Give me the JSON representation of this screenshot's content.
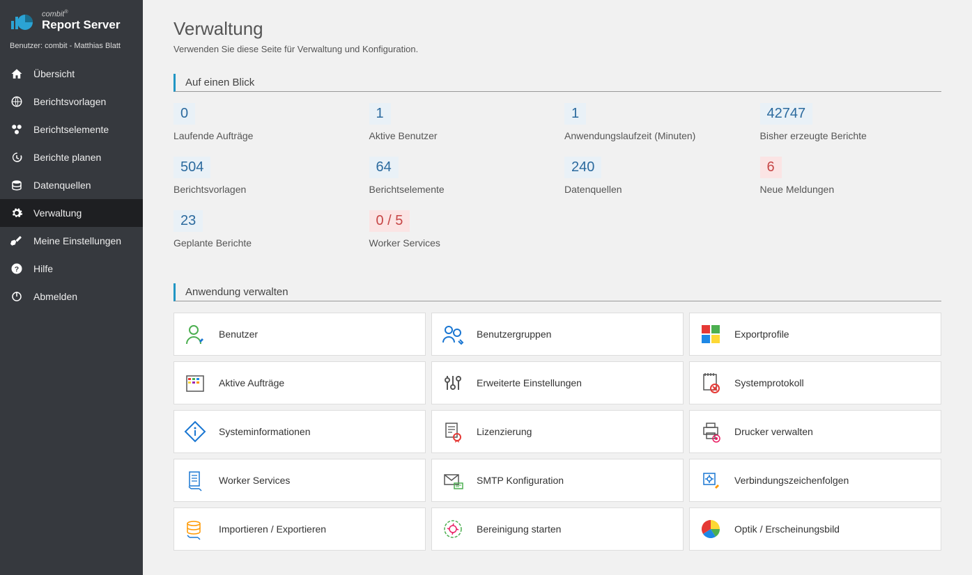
{
  "brand": {
    "top": "combit",
    "main": "Report Server",
    "sup": "®"
  },
  "user_label": "Benutzer: combit - Matthias Blatt",
  "nav": {
    "overview": "Übersicht",
    "templates": "Berichtsvorlagen",
    "elements": "Berichtselemente",
    "plan": "Berichte planen",
    "datasources": "Datenquellen",
    "admin": "Verwaltung",
    "settings": "Meine Einstellungen",
    "help": "Hilfe",
    "logout": "Abmelden"
  },
  "page": {
    "title": "Verwaltung",
    "subtitle": "Verwenden Sie diese Seite für Verwaltung und Konfiguration."
  },
  "sections": {
    "glance": "Auf einen Blick",
    "manage": "Anwendung verwalten"
  },
  "stats": {
    "running": {
      "value": "0",
      "label": "Laufende Aufträge"
    },
    "active_users": {
      "value": "1",
      "label": "Aktive Benutzer"
    },
    "uptime": {
      "value": "1",
      "label": "Anwendungslaufzeit (Minuten)"
    },
    "reports_total": {
      "value": "42747",
      "label": "Bisher erzeugte Berichte"
    },
    "templates": {
      "value": "504",
      "label": "Berichtsvorlagen"
    },
    "elements": {
      "value": "64",
      "label": "Berichtselemente"
    },
    "datasources": {
      "value": "240",
      "label": "Datenquellen"
    },
    "messages": {
      "value": "6",
      "label": "Neue Meldungen"
    },
    "scheduled": {
      "value": "23",
      "label": "Geplante Berichte"
    },
    "workers": {
      "value": "0 / 5",
      "label": "Worker Services"
    }
  },
  "tiles": {
    "users": "Benutzer",
    "groups": "Benutzergruppen",
    "export": "Exportprofile",
    "jobs": "Aktive Aufträge",
    "adv": "Erweiterte Einstellungen",
    "syslog": "Systemprotokoll",
    "sysinfo": "Systeminformationen",
    "license": "Lizenzierung",
    "printers": "Drucker verwalten",
    "worker": "Worker Services",
    "smtp": "SMTP Konfiguration",
    "conn": "Verbindungszeichenfolgen",
    "impexp": "Importieren / Exportieren",
    "cleanup": "Bereinigung starten",
    "look": "Optik / Erscheinungsbild"
  }
}
